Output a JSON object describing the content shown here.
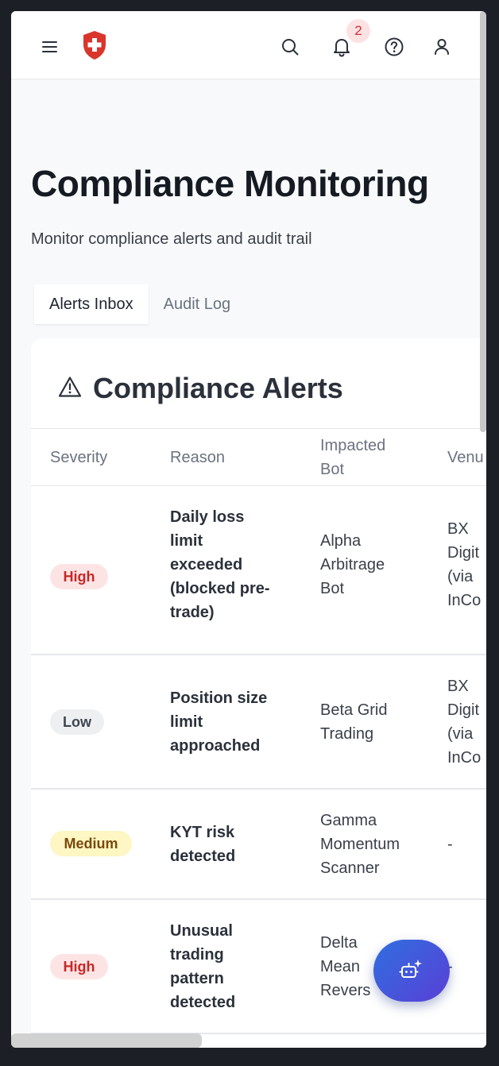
{
  "header": {
    "notification_count": "2",
    "icons": [
      "menu-icon",
      "shield-cross-logo",
      "search-icon",
      "bell-icon",
      "help-icon",
      "user-icon"
    ]
  },
  "page": {
    "title": "Compliance Monitoring",
    "subtitle": "Monitor compliance alerts and audit trail"
  },
  "tabs": [
    {
      "label": "Alerts Inbox",
      "active": true
    },
    {
      "label": "Audit Log",
      "active": false
    }
  ],
  "alerts_card": {
    "title": "Compliance Alerts",
    "columns": {
      "severity": "Severity",
      "reason": "Reason",
      "bot_line1": "Impacted",
      "bot_line2": "Bot",
      "venue": "Venu"
    },
    "rows": [
      {
        "severity": "High",
        "reason": [
          "Daily loss",
          "limit",
          "exceeded",
          "(blocked pre-",
          "trade)"
        ],
        "bot": [
          "Alpha",
          "Arbitrage",
          "Bot"
        ],
        "venue": [
          "BX",
          "Digit",
          "(via",
          "InCo"
        ]
      },
      {
        "severity": "Low",
        "reason": [
          "Position size",
          "limit",
          "approached"
        ],
        "bot": [
          "Beta Grid",
          "Trading"
        ],
        "venue": [
          "BX",
          "Digit",
          "(via",
          "InCo"
        ]
      },
      {
        "severity": "Medium",
        "reason": [
          "KYT risk",
          "detected"
        ],
        "bot": [
          "Gamma",
          "Momentum",
          "Scanner"
        ],
        "venue": [
          "-"
        ]
      },
      {
        "severity": "High",
        "reason": [
          "Unusual",
          "trading",
          "pattern",
          "detected"
        ],
        "bot": [
          "Delta",
          "Mean",
          "Revers"
        ],
        "venue": [
          "-"
        ]
      }
    ]
  },
  "colors": {
    "brand_red": "#d9352c",
    "fab_gradient_start": "#2f6fe0",
    "fab_gradient_end": "#5a3fd6",
    "high": "#c62828",
    "medium": "#7a4a0c"
  },
  "fab_icon": "ai-bot-sparkle-icon"
}
